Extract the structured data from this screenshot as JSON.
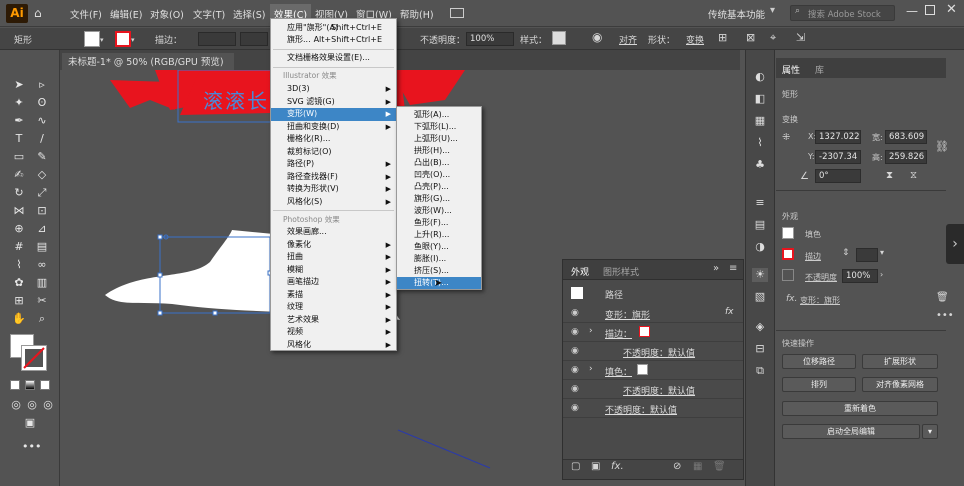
{
  "app": {
    "logo": "Ai"
  },
  "menubar": {
    "items": [
      "文件(F)",
      "编辑(E)",
      "对象(O)",
      "文字(T)",
      "选择(S)",
      "效果(C)",
      "视图(V)",
      "窗口(W)",
      "帮助(H)"
    ],
    "workspace": "传统基本功能",
    "search_placeholder": "搜索 Adobe Stock"
  },
  "control_bar": {
    "object_type": "矩形",
    "stroke_label": "描边：",
    "opacity_label": "不透明度：",
    "opacity_value": "100%",
    "style_label": "样式：",
    "align_label": "对齐",
    "shape_label": "形状：",
    "transform_label": "变换"
  },
  "document": {
    "tab_title": "未标题-1* @ 50% (RGB/GPU 预览)"
  },
  "canvas": {
    "banner_text": "滚滚长"
  },
  "effect_menu": {
    "apply_last": {
      "label": "应用\"旗形\"(A)",
      "shortcut": "Shift+Ctrl+E"
    },
    "last_effect": {
      "label": "旗形...",
      "shortcut": "Alt+Shift+Ctrl+E"
    },
    "raster_settings": "文档栅格效果设置(E)...",
    "illustrator_header": "Illustrator 效果",
    "illustrator_items": [
      "3D(3)",
      "SVG 滤镜(G)",
      "变形(W)",
      "扭曲和变换(D)",
      "栅格化(R)...",
      "裁剪标记(O)",
      "路径(P)",
      "路径查找器(F)",
      "转换为形状(V)",
      "风格化(S)"
    ],
    "photoshop_header": "Photoshop 效果",
    "photoshop_items": [
      "效果画廊...",
      "像素化",
      "扭曲",
      "模糊",
      "画笔描边",
      "素描",
      "纹理",
      "艺术效果",
      "视频",
      "风格化"
    ]
  },
  "warp_submenu": {
    "items": [
      "弧形(A)...",
      "下弧形(L)...",
      "上弧形(U)...",
      "拱形(H)...",
      "凸出(B)...",
      "凹壳(O)...",
      "凸壳(P)...",
      "旗形(G)...",
      "波形(W)...",
      "鱼形(F)...",
      "上升(R)...",
      "鱼眼(Y)...",
      "膨胀(I)...",
      "挤压(S)...",
      "扭转(T)..."
    ],
    "highlighted_index": 14
  },
  "appearance_panel": {
    "tabs": [
      "外观",
      "图形样式"
    ],
    "object_label": "路径",
    "effect_label": "变形：旗形",
    "fx_label": "fx",
    "stroke_label": "描边：",
    "stroke_opacity": "不透明度：默认值",
    "fill_label": "填色：",
    "fill_opacity": "不透明度：默认值",
    "opacity": "不透明度：默认值"
  },
  "properties_panel": {
    "tabs": [
      "属性",
      "库"
    ],
    "object_type": "矩形",
    "transform_header": "变换",
    "x_label": "X:",
    "x_value": "1327.022",
    "y_label": "Y:",
    "y_value": "-2307.34",
    "w_label": "宽:",
    "w_value": "683.609",
    "h_label": "高:",
    "h_value": "259.826",
    "angle_value": "0°",
    "appearance_header": "外观",
    "fill_label": "填色",
    "stroke_label": "描边",
    "opacity_label": "不透明度",
    "opacity_value": "100%",
    "effect_label": "变形：旗形",
    "fx_label": "fx.",
    "quick_actions_header": "快速操作",
    "btn_offset_path": "位移路径",
    "btn_expand_shape": "扩展形状",
    "btn_arrange": "排列",
    "btn_align_pixel": "对齐像素网格",
    "btn_recolor": "重新着色",
    "btn_global_edit": "启动全局编辑"
  },
  "colors": {
    "menu_highlight": "#3d86c6",
    "banner_red": "#e8141e",
    "ui_dark": "#535353"
  }
}
